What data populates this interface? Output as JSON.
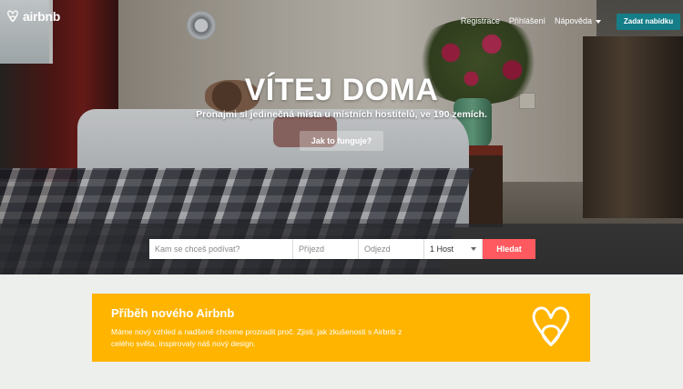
{
  "nav": {
    "logo_text": "airbnb",
    "links": [
      "Registrace",
      "Přihlášení",
      "Nápověda"
    ],
    "host_button": "Zadat nabídku"
  },
  "hero": {
    "headline": "VÍTEJ DOMA",
    "subline": "Pronajmi si jedinečná místa u místních hostitelů, ve 190 zemích.",
    "how_button": "Jak to funguje?"
  },
  "search": {
    "where_placeholder": "Kam se chceš podívat?",
    "checkin_placeholder": "Příjezd",
    "checkout_placeholder": "Odjezd",
    "guests_value": "1 Host",
    "submit_label": "Hledat"
  },
  "promo": {
    "title": "Příběh nového Airbnb",
    "text": "Máme nový vzhled a nadšeně chceme prozradit proč. Zjisti, jak zkušenosti s Airbnb z celého světa, inspirovaly náš nový design."
  },
  "colors": {
    "brand": "#ff5a5f",
    "host_button": "#157e88",
    "promo_bg": "#ffb400",
    "page_bg": "#edefed"
  },
  "icons": [
    "airbnb-belo-icon",
    "chevron-down-icon"
  ]
}
